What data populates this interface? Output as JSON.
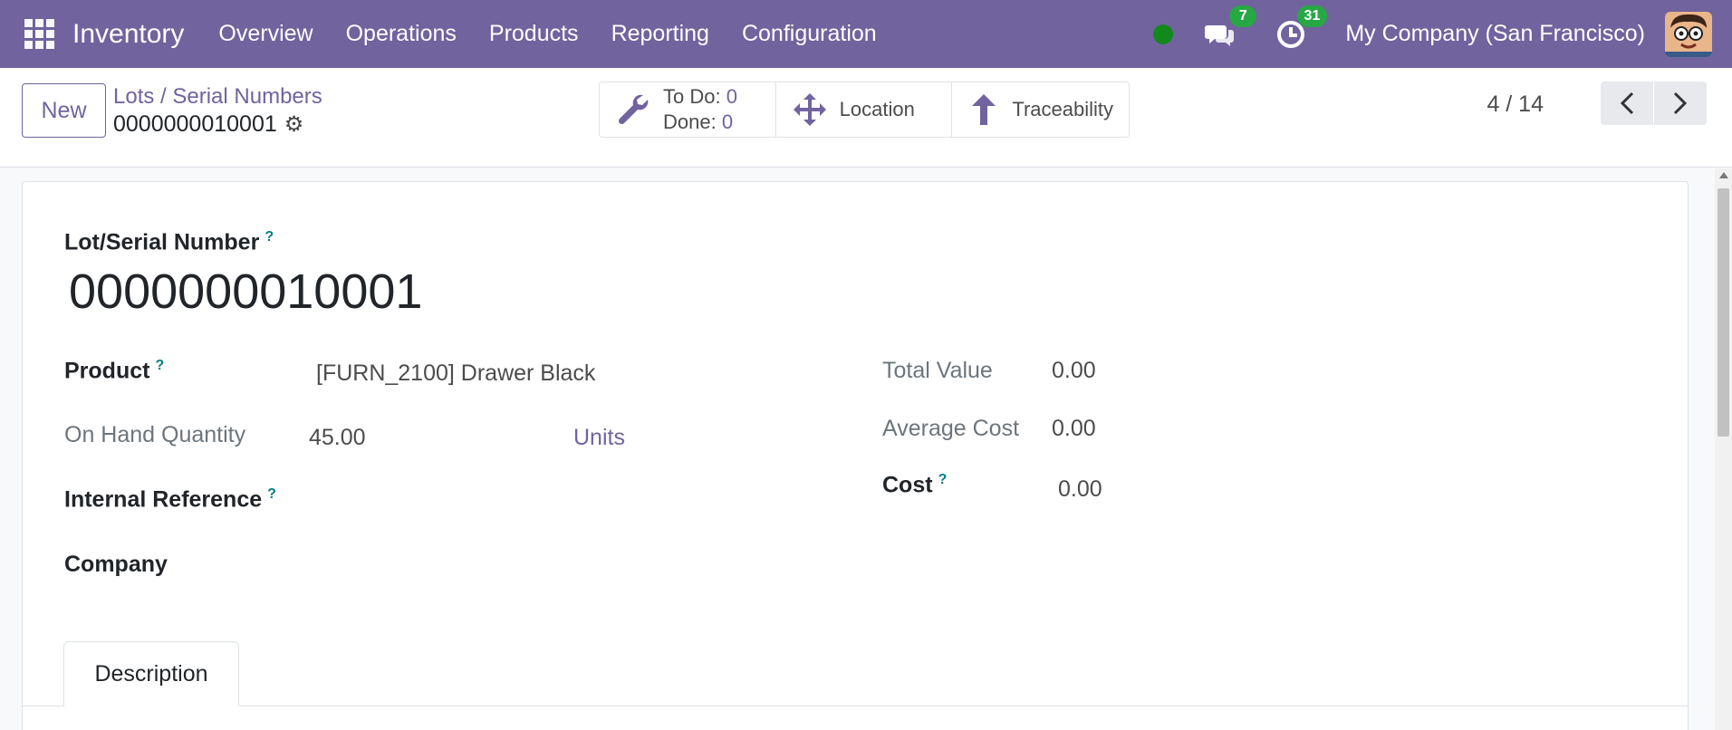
{
  "navbar": {
    "brand": "Inventory",
    "menu": [
      "Overview",
      "Operations",
      "Products",
      "Reporting",
      "Configuration"
    ],
    "messages_badge": "7",
    "activities_badge": "31",
    "company": "My Company (San Francisco)"
  },
  "control": {
    "new_label": "New",
    "breadcrumb": "Lots / Serial Numbers",
    "record_name": "0000000010001",
    "smart": {
      "todo_label": "To Do:",
      "todo_value": "0",
      "done_label": "Done:",
      "done_value": "0",
      "location": "Location",
      "traceability": "Traceability"
    },
    "pager": "4 / 14"
  },
  "form": {
    "lot_label": "Lot/Serial Number",
    "lot_value": "0000000010001",
    "product_label": "Product",
    "product_value": "[FURN_2100] Drawer Black",
    "onhand_label": "On Hand Quantity",
    "onhand_value": "45.00",
    "onhand_uom": "Units",
    "internal_ref_label": "Internal Reference",
    "company_label": "Company",
    "total_value_label": "Total Value",
    "total_value": "0.00",
    "avg_cost_label": "Average Cost",
    "avg_cost": "0.00",
    "cost_label": "Cost",
    "cost": "0.00",
    "tab_description": "Description",
    "help_mark": "?"
  },
  "colors": {
    "brand": "#71639e",
    "status_online": "#13891d",
    "badge": "#28a745"
  }
}
